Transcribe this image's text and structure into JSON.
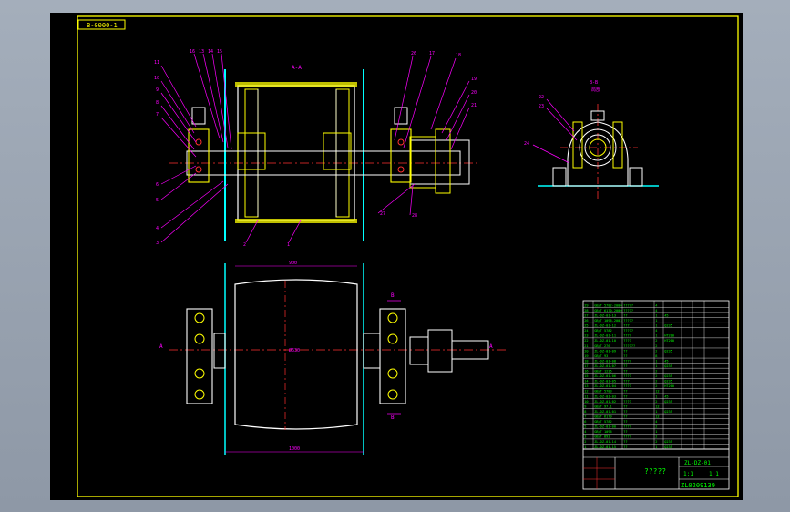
{
  "drawing": {
    "number_box": "B-0000-1",
    "section_aa": "A-A",
    "section_bb": "B-B",
    "view_note": "局部",
    "section_mark_a": "A",
    "section_mark_b": "B",
    "dim_top": "900",
    "dim_bottom": "1000",
    "dim_mid": "Ø630",
    "callouts_left": [
      "11",
      "10",
      "9",
      "8",
      "7",
      "6",
      "5",
      "4",
      "3"
    ],
    "callouts_top": [
      "16",
      "13",
      "14",
      "15"
    ],
    "callouts_right": [
      "26",
      "17",
      "18",
      "19",
      "20",
      "21"
    ],
    "callouts_bottom": [
      "2",
      "1",
      "27",
      "28"
    ],
    "callouts_side": [
      "22",
      "23",
      "24"
    ]
  },
  "title_block": {
    "code": "ZL-DZ-01",
    "title": "?????",
    "drawing_no": "ZL0209139",
    "scale_label": "1:1",
    "sheet": "1  1",
    "rows": [
      [
        "29",
        "GB/T 5782-2000",
        "?????",
        "4",
        "",
        "",
        "",
        ""
      ],
      [
        "28",
        "GB/T 6170-2000",
        "?????",
        "4",
        "",
        "",
        "",
        ""
      ],
      [
        "27",
        "ZL-DZ-01-13",
        "??",
        "1",
        "45",
        "",
        "",
        ""
      ],
      [
        "26",
        "GB/T 1096-2003",
        "?????",
        "1",
        "",
        "",
        "",
        ""
      ],
      [
        "25",
        "ZL-DZ-01-12",
        "???",
        "1",
        "Q235",
        "",
        "",
        ""
      ],
      [
        "24",
        "GB/T 5782",
        "?????",
        "4",
        "",
        "",
        "",
        ""
      ],
      [
        "23",
        "ZL-DZ-01-11",
        "????",
        "1",
        "HT200",
        "",
        "",
        ""
      ],
      [
        "22",
        "ZL-DZ-01-10",
        "????",
        "2",
        "HT200",
        "",
        "",
        ""
      ],
      [
        "21",
        "GB/T 276",
        "??????",
        "2",
        "",
        "",
        "",
        ""
      ],
      [
        "20",
        "ZL-DZ-01-09",
        "??",
        "2",
        "Q235",
        "",
        "",
        ""
      ],
      [
        "19",
        "GB/T 93",
        "??",
        "8",
        "",
        "",
        "",
        ""
      ],
      [
        "18",
        "ZL-DZ-01-08",
        "????",
        "1",
        "45",
        "",
        "",
        ""
      ],
      [
        "17",
        "ZL-DZ-01-07",
        "??",
        "1",
        "Q235",
        "",
        "",
        ""
      ],
      [
        "16",
        "GB/T 1235",
        "??",
        "2",
        "",
        "",
        "",
        ""
      ],
      [
        "15",
        "ZL-DZ-01-06",
        "????",
        "2",
        "Q235",
        "",
        "",
        ""
      ],
      [
        "14",
        "ZL-DZ-01-05",
        "???",
        "2",
        "Q235",
        "",
        "",
        ""
      ],
      [
        "13",
        "ZL-DZ-01-04",
        "????",
        "2",
        "HT200",
        "",
        "",
        ""
      ],
      [
        "12",
        "GB/T 5783",
        "??",
        "12",
        "",
        "",
        "",
        ""
      ],
      [
        "11",
        "ZL-DZ-01-03",
        "??",
        "1",
        "45",
        "",
        "",
        ""
      ],
      [
        "10",
        "ZL-DZ-01-02",
        "????",
        "2",
        "Q235",
        "",
        "",
        ""
      ],
      [
        "9",
        "GB/T 97.1",
        "??",
        "12",
        "",
        "",
        "",
        ""
      ],
      [
        "8",
        "ZL-DZ-01-01",
        "??",
        "1",
        "Q235",
        "",
        "",
        ""
      ],
      [
        "7",
        "GB/T 6170",
        "??",
        "12",
        "",
        "",
        "",
        ""
      ],
      [
        "6",
        "GB/T 5782",
        "??",
        "4",
        "",
        "",
        "",
        ""
      ],
      [
        "5",
        "ZL-DZ-01-00",
        "????",
        "2",
        "",
        "",
        "",
        ""
      ],
      [
        "4",
        "GB/T 1096",
        "??",
        "1",
        "",
        "",
        "",
        ""
      ],
      [
        "3",
        "GB/T 893",
        "????",
        "2",
        "",
        "",
        "",
        ""
      ],
      [
        "2",
        "ZL-DZ-01-14",
        "??",
        "2",
        "Q235",
        "",
        "",
        ""
      ],
      [
        "1",
        "ZL-DZ-01-15",
        "??",
        "1",
        "Q235",
        "",
        "",
        ""
      ]
    ]
  },
  "colors": {
    "background": "#000000",
    "frame": "#ffff00",
    "outline": "#ffffff",
    "center": "#ff3030",
    "callout": "#ff00ff",
    "section": "#00ffff",
    "title_lines": "#00ff00"
  }
}
